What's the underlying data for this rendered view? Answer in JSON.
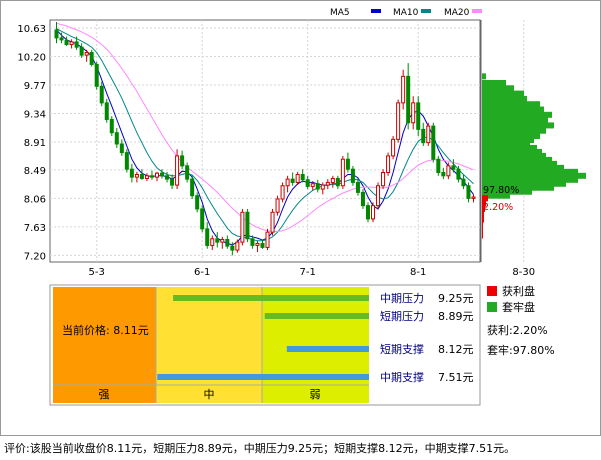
{
  "legend": [
    {
      "label": "MA5",
      "color": "#0000cc"
    },
    {
      "label": "MA10",
      "color": "#008888"
    },
    {
      "label": "MA20",
      "color": "#ff88ff"
    }
  ],
  "chart_data": [
    {
      "type": "candlestick",
      "y_ticks": [
        10.63,
        10.2,
        9.77,
        9.34,
        8.91,
        8.49,
        8.06,
        7.63,
        7.2
      ],
      "ylim": [
        7.1,
        10.75
      ],
      "x_ticks": [
        "5-3",
        "6-1",
        "7-1",
        "8-1",
        "8-30"
      ],
      "x_tick_index": [
        8,
        29,
        50,
        72,
        93
      ],
      "grid": true,
      "colors": {
        "up": "#cc0000",
        "down": "#008800"
      },
      "candles": [
        [
          10.6,
          10.72,
          10.4,
          10.48
        ],
        [
          10.48,
          10.56,
          10.4,
          10.45
        ],
        [
          10.44,
          10.5,
          10.36,
          10.38
        ],
        [
          10.38,
          10.46,
          10.32,
          10.42
        ],
        [
          10.42,
          10.5,
          10.3,
          10.34
        ],
        [
          10.34,
          10.4,
          10.18,
          10.22
        ],
        [
          10.22,
          10.3,
          10.12,
          10.26
        ],
        [
          10.26,
          10.3,
          10.05,
          10.08
        ],
        [
          10.08,
          10.12,
          9.7,
          9.75
        ],
        [
          9.75,
          9.82,
          9.45,
          9.5
        ],
        [
          9.5,
          9.56,
          9.2,
          9.25
        ],
        [
          9.25,
          9.3,
          9.0,
          9.05
        ],
        [
          9.05,
          9.12,
          8.82,
          8.88
        ],
        [
          8.88,
          8.95,
          8.7,
          8.75
        ],
        [
          8.75,
          8.8,
          8.45,
          8.5
        ],
        [
          8.5,
          8.58,
          8.3,
          8.38
        ],
        [
          8.38,
          8.46,
          8.3,
          8.42
        ],
        [
          8.42,
          8.5,
          8.34,
          8.36
        ],
        [
          8.36,
          8.44,
          8.32,
          8.4
        ],
        [
          8.4,
          8.48,
          8.34,
          8.38
        ],
        [
          8.38,
          8.46,
          8.32,
          8.44
        ],
        [
          8.44,
          8.5,
          8.36,
          8.4
        ],
        [
          8.4,
          8.46,
          8.3,
          8.35
        ],
        [
          8.35,
          8.42,
          8.2,
          8.26
        ],
        [
          8.26,
          8.8,
          8.2,
          8.7
        ],
        [
          8.7,
          8.78,
          8.5,
          8.55
        ],
        [
          8.55,
          8.6,
          8.3,
          8.35
        ],
        [
          8.35,
          8.4,
          8.05,
          8.1
        ],
        [
          8.1,
          8.15,
          7.85,
          7.9
        ],
        [
          7.9,
          7.95,
          7.55,
          7.6
        ],
        [
          7.6,
          7.7,
          7.3,
          7.35
        ],
        [
          7.35,
          7.5,
          7.28,
          7.45
        ],
        [
          7.45,
          7.55,
          7.32,
          7.4
        ],
        [
          7.4,
          7.48,
          7.3,
          7.44
        ],
        [
          7.44,
          7.5,
          7.3,
          7.34
        ],
        [
          7.34,
          7.4,
          7.2,
          7.28
        ],
        [
          7.28,
          7.44,
          7.24,
          7.4
        ],
        [
          7.4,
          7.9,
          7.35,
          7.85
        ],
        [
          7.85,
          7.9,
          7.4,
          7.45
        ],
        [
          7.45,
          7.5,
          7.3,
          7.35
        ],
        [
          7.35,
          7.42,
          7.25,
          7.38
        ],
        [
          7.38,
          7.44,
          7.3,
          7.32
        ],
        [
          7.32,
          7.6,
          7.28,
          7.55
        ],
        [
          7.55,
          7.9,
          7.5,
          7.85
        ],
        [
          7.85,
          8.1,
          7.8,
          8.05
        ],
        [
          8.05,
          8.3,
          8.0,
          8.25
        ],
        [
          8.25,
          8.4,
          8.15,
          8.35
        ],
        [
          8.35,
          8.45,
          8.25,
          8.3
        ],
        [
          8.3,
          8.46,
          8.26,
          8.42
        ],
        [
          8.42,
          8.5,
          8.3,
          8.34
        ],
        [
          8.34,
          8.4,
          8.2,
          8.24
        ],
        [
          8.24,
          8.32,
          8.18,
          8.28
        ],
        [
          8.28,
          8.34,
          8.15,
          8.2
        ],
        [
          8.2,
          8.3,
          8.12,
          8.26
        ],
        [
          8.26,
          8.35,
          8.2,
          8.3
        ],
        [
          8.3,
          8.4,
          8.22,
          8.36
        ],
        [
          8.36,
          8.4,
          8.2,
          8.25
        ],
        [
          8.25,
          8.7,
          8.2,
          8.65
        ],
        [
          8.65,
          8.75,
          8.45,
          8.5
        ],
        [
          8.5,
          8.55,
          8.25,
          8.3
        ],
        [
          8.3,
          8.36,
          8.1,
          8.15
        ],
        [
          8.15,
          8.2,
          7.9,
          7.95
        ],
        [
          7.95,
          8.0,
          7.7,
          7.75
        ],
        [
          7.75,
          8.0,
          7.7,
          7.95
        ],
        [
          7.95,
          8.3,
          7.9,
          8.25
        ],
        [
          8.25,
          8.5,
          8.2,
          8.45
        ],
        [
          8.45,
          8.75,
          8.4,
          8.7
        ],
        [
          8.7,
          9.0,
          8.65,
          8.95
        ],
        [
          8.95,
          9.55,
          8.9,
          9.5
        ],
        [
          9.5,
          10.0,
          9.4,
          9.9
        ],
        [
          9.9,
          10.1,
          9.1,
          9.2
        ],
        [
          9.2,
          9.6,
          9.1,
          9.5
        ],
        [
          9.5,
          9.6,
          9.0,
          9.1
        ],
        [
          9.1,
          9.2,
          8.85,
          8.9
        ],
        [
          8.9,
          9.2,
          8.85,
          9.15
        ],
        [
          9.15,
          9.2,
          8.6,
          8.65
        ],
        [
          8.65,
          8.7,
          8.4,
          8.45
        ],
        [
          8.45,
          8.52,
          8.35,
          8.4
        ],
        [
          8.4,
          8.6,
          8.35,
          8.55
        ],
        [
          8.55,
          8.65,
          8.45,
          8.5
        ],
        [
          8.5,
          8.55,
          8.3,
          8.35
        ],
        [
          8.35,
          8.42,
          8.2,
          8.25
        ],
        [
          8.25,
          8.3,
          8.0,
          8.06
        ],
        [
          8.06,
          8.12,
          8.0,
          8.08
        ]
      ],
      "ma_series": [
        {
          "name": "MA5",
          "color": "#0000cc",
          "values": [
            10.6,
            10.52,
            10.45,
            10.42,
            10.39,
            10.34,
            10.28,
            10.2,
            10.05,
            9.85,
            9.64,
            9.45,
            9.25,
            9.05,
            8.85,
            8.65,
            8.52,
            8.44,
            8.4,
            8.39,
            8.4,
            8.4,
            8.39,
            8.35,
            8.4,
            8.47,
            8.46,
            8.38,
            8.2,
            8.0,
            7.75,
            7.57,
            7.46,
            7.41,
            7.38,
            7.36,
            7.4,
            7.5,
            7.5,
            7.48,
            7.46,
            7.43,
            7.46,
            7.55,
            7.7,
            7.9,
            8.08,
            8.2,
            8.28,
            8.32,
            8.3,
            8.3,
            8.28,
            8.26,
            8.26,
            8.28,
            8.28,
            8.36,
            8.42,
            8.42,
            8.37,
            8.25,
            8.08,
            7.95,
            7.9,
            8.02,
            8.2,
            8.45,
            8.75,
            9.05,
            9.25,
            9.35,
            9.38,
            9.3,
            9.15,
            9.0,
            8.8,
            8.65,
            8.55,
            8.48,
            8.4,
            8.32,
            8.22,
            8.12
          ]
        },
        {
          "name": "MA10",
          "color": "#008888",
          "values": [
            10.62,
            10.58,
            10.54,
            10.5,
            10.47,
            10.43,
            10.39,
            10.34,
            10.26,
            10.14,
            10.0,
            9.86,
            9.72,
            9.57,
            9.4,
            9.22,
            9.05,
            8.9,
            8.75,
            8.62,
            8.52,
            8.46,
            8.42,
            8.4,
            8.4,
            8.42,
            8.44,
            8.41,
            8.33,
            8.22,
            8.08,
            7.95,
            7.83,
            7.72,
            7.61,
            7.53,
            7.49,
            7.48,
            7.46,
            7.44,
            7.42,
            7.42,
            7.44,
            7.48,
            7.55,
            7.65,
            7.77,
            7.88,
            7.98,
            8.06,
            8.12,
            8.18,
            8.22,
            8.25,
            8.26,
            8.27,
            8.27,
            8.3,
            8.33,
            8.35,
            8.34,
            8.3,
            8.22,
            8.14,
            8.08,
            8.05,
            8.07,
            8.16,
            8.3,
            8.48,
            8.65,
            8.8,
            8.92,
            8.98,
            8.98,
            8.94,
            8.85,
            8.75,
            8.66,
            8.58,
            8.5,
            8.42,
            8.35,
            8.28
          ]
        },
        {
          "name": "MA20",
          "color": "#ff88ff",
          "values": [
            10.7,
            10.68,
            10.66,
            10.63,
            10.6,
            10.57,
            10.53,
            10.49,
            10.44,
            10.38,
            10.31,
            10.22,
            10.12,
            10.02,
            9.91,
            9.79,
            9.67,
            9.54,
            9.41,
            9.28,
            9.15,
            9.02,
            8.9,
            8.79,
            8.69,
            8.6,
            8.53,
            8.47,
            8.41,
            8.35,
            8.29,
            8.22,
            8.15,
            8.07,
            7.99,
            7.91,
            7.84,
            7.77,
            7.71,
            7.66,
            7.62,
            7.59,
            7.57,
            7.56,
            7.56,
            7.57,
            7.6,
            7.64,
            7.69,
            7.74,
            7.8,
            7.86,
            7.92,
            7.97,
            8.02,
            8.06,
            8.1,
            8.14,
            8.17,
            8.2,
            8.22,
            8.23,
            8.23,
            8.23,
            8.22,
            8.22,
            8.23,
            8.26,
            8.3,
            8.36,
            8.43,
            8.5,
            8.56,
            8.6,
            8.63,
            8.64,
            8.64,
            8.63,
            8.62,
            8.6,
            8.58,
            8.55,
            8.52,
            8.49
          ]
        }
      ],
      "chip_distribution": {
        "profit_color": "#ee0000",
        "locked_color": "#22aa22",
        "profit_pct_label": "97.80%",
        "locked_pct_label": "2.20%",
        "bars": [
          [
            9.9,
            4
          ],
          [
            9.8,
            24
          ],
          [
            9.72,
            32
          ],
          [
            9.64,
            42
          ],
          [
            9.56,
            45
          ],
          [
            9.48,
            58
          ],
          [
            9.4,
            62
          ],
          [
            9.32,
            70
          ],
          [
            9.24,
            66
          ],
          [
            9.16,
            72
          ],
          [
            9.08,
            64
          ],
          [
            9.0,
            58
          ],
          [
            8.94,
            52
          ],
          [
            8.88,
            48
          ],
          [
            8.82,
            55
          ],
          [
            8.76,
            60
          ],
          [
            8.7,
            64
          ],
          [
            8.64,
            70
          ],
          [
            8.58,
            75
          ],
          [
            8.52,
            82
          ],
          [
            8.46,
            96
          ],
          [
            8.4,
            104
          ],
          [
            8.34,
            96
          ],
          [
            8.28,
            84
          ],
          [
            8.22,
            72
          ],
          [
            8.16,
            50
          ],
          [
            8.1,
            28
          ]
        ],
        "profit_bars": [
          [
            8.06,
            6
          ],
          [
            7.98,
            4
          ],
          [
            7.9,
            3
          ],
          [
            7.82,
            2
          ],
          [
            7.74,
            2
          ],
          [
            7.66,
            1
          ],
          [
            7.58,
            1
          ],
          [
            7.5,
            1
          ]
        ]
      }
    },
    {
      "type": "support-resistance",
      "zones": [
        "强",
        "中",
        "弱"
      ],
      "current_price_label": "当前价格: 8.11元",
      "levels": [
        {
          "label": "中期压力",
          "value_label": "9.25元",
          "value": 9.25,
          "color": "#66bb22"
        },
        {
          "label": "短期压力",
          "value_label": "8.89元",
          "value": 8.89,
          "color": "#66bb22"
        },
        {
          "label": "短期支撑",
          "value_label": "8.12元",
          "value": 8.12,
          "color": "#4499dd"
        },
        {
          "label": "中期支撑",
          "value_label": "7.51元",
          "value": 7.51,
          "color": "#4499dd"
        }
      ],
      "bar_fractions": [
        0.62,
        0.33,
        0.26,
        0.67
      ]
    }
  ],
  "side_legend": {
    "profit_label": "获利盘",
    "locked_label": "套牢盘",
    "profit_ratio": "获利:2.20%",
    "locked_ratio": "套牢:97.80%"
  },
  "comment": "评价:该股当前收盘价8.11元，短期压力8.89元，中期压力9.25元；短期支撑8.12元，中期支撑7.51元。"
}
